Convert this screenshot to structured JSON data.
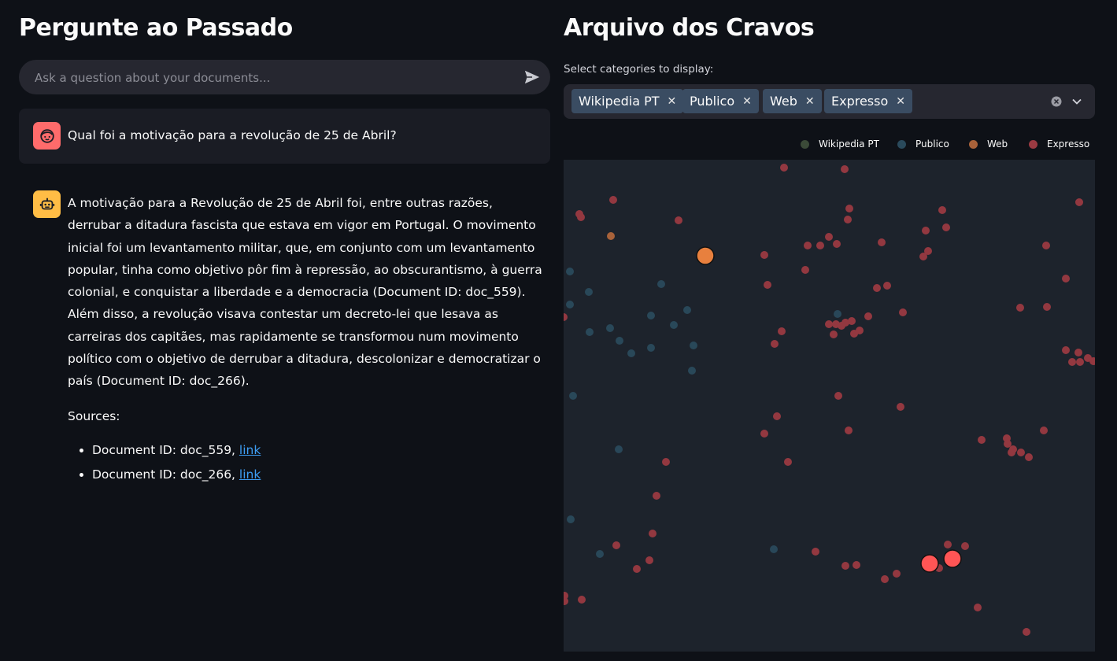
{
  "left": {
    "title": "Pergunte ao Passado",
    "chat_input": {
      "placeholder": "Ask a question about your documents..."
    },
    "user_message": "Qual foi a motivação para a revolução de 25 de Abril?",
    "assistant_message": "A motivação para a Revolução de 25 de Abril foi, entre outras razões, derrubar a ditadura fascista que estava em vigor em Portugal. O movimento inicial foi um levantamento militar, que, em conjunto com um levantamento popular, tinha como objetivo pôr fim à repressão, ao obscurantismo, à guerra colonial, e conquistar a liberdade e a democracia (Document ID: doc_559). Além disso, a revolução visava contestar um decreto-lei que lesava as carreiras dos capitães, mas rapidamente se transformou num movimento político com o objetivo de derrubar a ditadura, descolonizar e democratizar o país (Document ID: doc_266).",
    "sources_label": "Sources:",
    "sources": [
      {
        "text": "Document ID: doc_559, ",
        "link": "link"
      },
      {
        "text": "Document ID: doc_266, ",
        "link": "link"
      }
    ]
  },
  "right": {
    "title": "Arquivo dos Cravos",
    "category_label": "Select categories to display:",
    "selected_categories": [
      "Wikipedia PT",
      "Publico",
      "Web",
      "Expresso"
    ],
    "legend": [
      {
        "label": "Wikipedia PT",
        "color": "#3b4a38"
      },
      {
        "label": "Publico",
        "color": "#2a4a5c"
      },
      {
        "label": "Web",
        "color": "#a8623a"
      },
      {
        "label": "Expresso",
        "color": "#9a3a42"
      }
    ]
  },
  "colors": {
    "background": "#0e1117",
    "plot_bg": "#1d232c",
    "highlight_web": "#e8803e",
    "highlight_expresso": "#ff5555"
  }
}
